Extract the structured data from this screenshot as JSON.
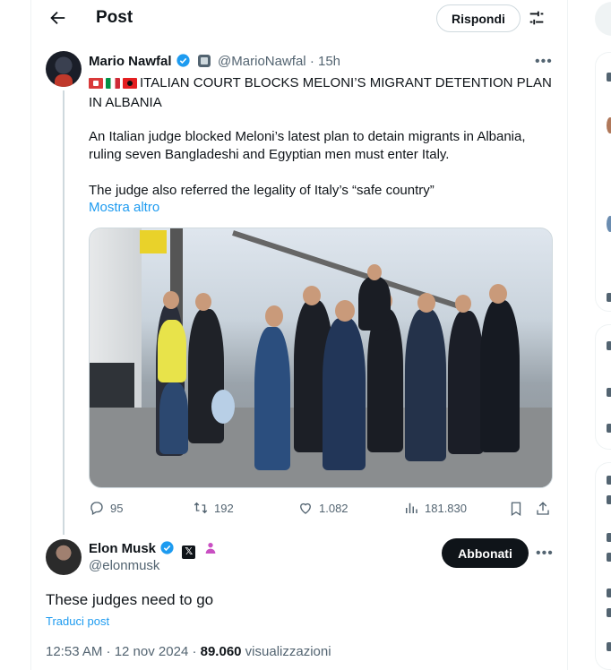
{
  "header": {
    "title": "Post",
    "reply_button": "Rispondi"
  },
  "parent_tweet": {
    "author_name": "Mario Nawfal",
    "handle": "@MarioNawfal",
    "separator": "·",
    "time_ago": "15h",
    "headline": "ITALIAN COURT BLOCKS MELONI’S MIGRANT DETENTION PLAN IN ALBANIA",
    "paragraph_1": "An Italian judge blocked Meloni’s latest plan to detain migrants in Albania, ruling seven Bangladeshi and Egyptian men must enter Italy.",
    "paragraph_2": "The judge also referred the legality of Italy’s “safe country”",
    "show_more": "Mostra altro",
    "flag_icons": [
      "red-square-flag",
      "italy-flag",
      "albania-flag"
    ],
    "stats": {
      "replies": "95",
      "reposts": "192",
      "likes": "1.082",
      "views": "181.830"
    }
  },
  "reply_tweet": {
    "author_name": "Elon Musk",
    "handle": "@elonmusk",
    "x_badge": "𝕏",
    "subscribe_button": "Abbonati",
    "text": "These judges need to go",
    "translate_link": "Traduci post",
    "timestamp": "12:53 AM · 12 nov 2024 · ",
    "views_count": "89.060",
    "views_label": " visualizzazioni"
  },
  "colors": {
    "text": "#0f1419",
    "muted": "#536471",
    "link": "#1d9bf0",
    "border": "#cfd9de"
  }
}
